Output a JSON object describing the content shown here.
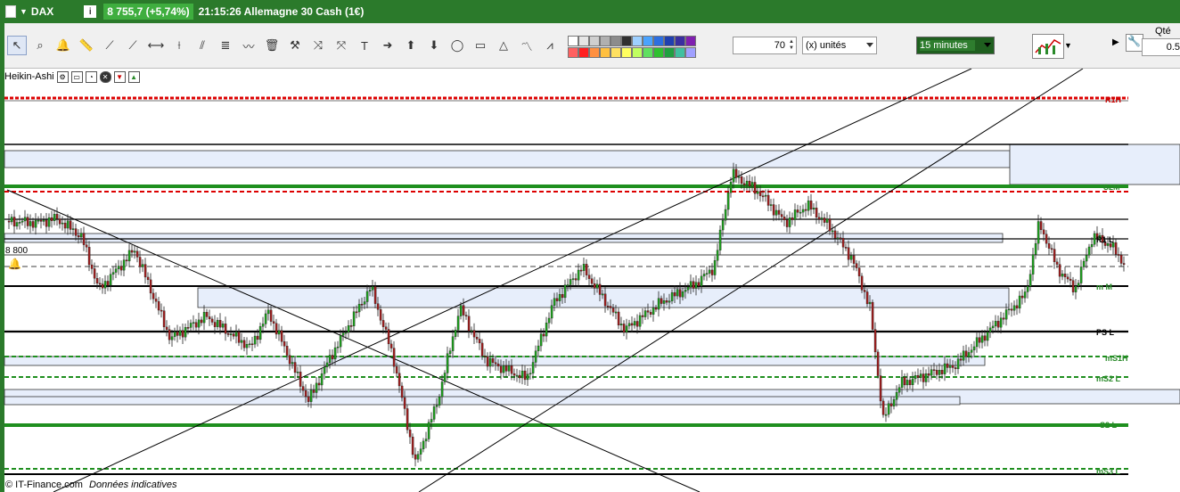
{
  "titlebar": {
    "symbol": "DAX",
    "info_label": "i",
    "price_change": "8 755,7 (+5,74%)",
    "time_and_instrument": "21:15:26 Allemagne 30 Cash (1€)"
  },
  "toolbar": {
    "tools": [
      {
        "icon": "cursor-icon",
        "glyph": "↖"
      },
      {
        "icon": "magnifier-icon",
        "glyph": "⌕"
      },
      {
        "icon": "bell-icon",
        "glyph": "🔔"
      },
      {
        "icon": "ruler-icon",
        "glyph": "📏"
      },
      {
        "icon": "line-icon",
        "glyph": "⟋"
      },
      {
        "icon": "ray-icon",
        "glyph": "⟋"
      },
      {
        "icon": "horizontal-line-icon",
        "glyph": "⟷"
      },
      {
        "icon": "vertical-line-icon",
        "glyph": "⟊"
      },
      {
        "icon": "parallel-channel-icon",
        "glyph": "⫽"
      },
      {
        "icon": "fibonacci-icon",
        "glyph": "≣"
      },
      {
        "icon": "pencil-icon",
        "glyph": "〰"
      },
      {
        "icon": "trash-icon",
        "glyph": "🗑"
      },
      {
        "icon": "hammer-icon",
        "glyph": "⚒"
      },
      {
        "icon": "cross-arrows-icon",
        "glyph": "⤨"
      },
      {
        "icon": "cross-arrows-alt-icon",
        "glyph": "⤧"
      },
      {
        "icon": "text-icon",
        "glyph": "T"
      },
      {
        "icon": "arrow-right-icon",
        "glyph": "➜"
      },
      {
        "icon": "arrow-up-icon",
        "glyph": "⬆"
      },
      {
        "icon": "arrow-down-icon",
        "glyph": "⬇"
      },
      {
        "icon": "ellipse-icon",
        "glyph": "◯"
      },
      {
        "icon": "rectangle-icon",
        "glyph": "▭"
      },
      {
        "icon": "triangle-icon",
        "glyph": "△"
      },
      {
        "icon": "wave-icon",
        "glyph": "〽"
      },
      {
        "icon": "pattern-icon",
        "glyph": "⩘"
      }
    ],
    "swatch_colors": [
      "#ffffff",
      "#e6e6e6",
      "#cfcfcf",
      "#b0b0b0",
      "#8c8c8c",
      "#303030",
      "#9ed0ff",
      "#4aa3ff",
      "#2d6fe0",
      "#2040b0",
      "#3a2fa0",
      "#8020b0",
      "#ff6060",
      "#ff2020",
      "#ff9040",
      "#ffc040",
      "#ffe060",
      "#ffff60",
      "#c0ff60",
      "#60e060",
      "#30c030",
      "#20a040",
      "#40c0a0",
      "#a0a0ff"
    ],
    "quantity_value": "70",
    "unit_label": "(x) unités",
    "timeframe_label": "15 minutes",
    "qte_label": "Qté",
    "qte_value": "0.5"
  },
  "indicator_bar": {
    "name": "Heikin-Ashi"
  },
  "chart_data": {
    "type": "candlestick",
    "instrument": "Allemagne 30 Cash (1€)",
    "timeframe": "15 minutes",
    "y_axis_visible_label": "8 800",
    "levels": [
      {
        "label": "R1H",
        "color": "#cc0000",
        "style": "dashed"
      },
      {
        "label": "S2M",
        "color": "#2a8a2a",
        "style": "solid"
      },
      {
        "label": "R1 L",
        "color": "#000000",
        "style": "solid"
      },
      {
        "label": "m M",
        "color": "#2a8a2a",
        "style": "solid"
      },
      {
        "label": "PS L",
        "color": "#000000",
        "style": "solid"
      },
      {
        "label": "mS1H",
        "color": "#2a8a2a",
        "style": "dashed"
      },
      {
        "label": "mS2 L",
        "color": "#2a8a2a",
        "style": "dashed"
      },
      {
        "label": "S2 L",
        "color": "#2a8a2a",
        "style": "solid"
      },
      {
        "label": "mS3 L",
        "color": "#2a8a2a",
        "style": "dashed"
      }
    ]
  },
  "footer": {
    "brand": "© IT-Finance.com",
    "note": "Données indicatives"
  }
}
